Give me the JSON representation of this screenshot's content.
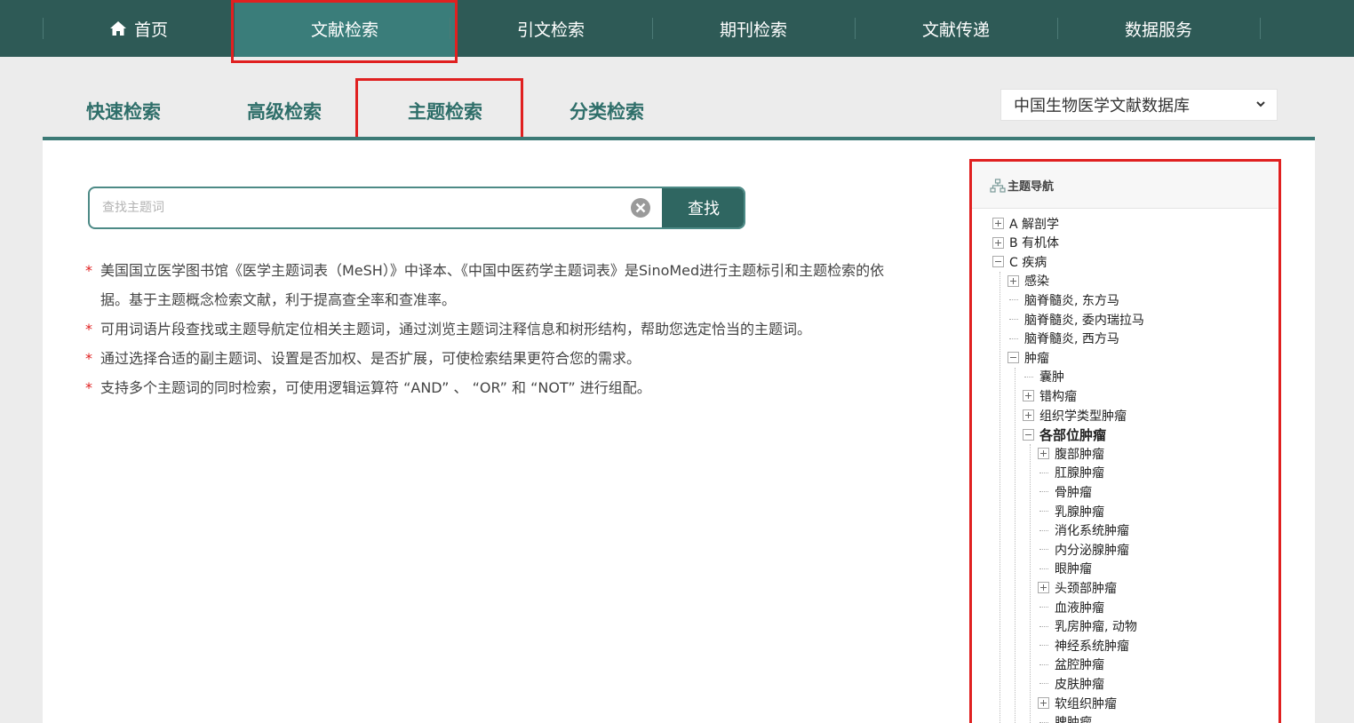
{
  "topnav": {
    "items": [
      {
        "label": "首页"
      },
      {
        "label": "文献检索"
      },
      {
        "label": "引文检索"
      },
      {
        "label": "期刊检索"
      },
      {
        "label": "文献传递"
      },
      {
        "label": "数据服务"
      }
    ],
    "active": "文献检索"
  },
  "subtabs": {
    "items": [
      {
        "label": "快速检索"
      },
      {
        "label": "高级检索"
      },
      {
        "label": "主题检索"
      },
      {
        "label": "分类检索"
      }
    ],
    "active": "主题检索"
  },
  "database_select": {
    "value": "中国生物医学文献数据库"
  },
  "search": {
    "placeholder": "查找主题词",
    "value": "",
    "button_label": "查找"
  },
  "notes": [
    "美国国立医学图书馆《医学主题词表（MeSH）》中译本、《中国中医药学主题词表》是SinoMed进行主题标引和主题检索的依据。基于主题概念检索文献，利于提高查全率和查准率。",
    "可用词语片段查找或主题导航定位相关主题词，通过浏览主题词注释信息和树形结构，帮助您选定恰当的主题词。",
    "通过选择合适的副主题词、设置是否加权、是否扩展，可使检索结果更符合您的需求。",
    "支持多个主题词的同时检索，可使用逻辑运算符 “AND” 、 “OR” 和 “NOT” 进行组配。"
  ],
  "tree": {
    "title": "主题导航",
    "nodes": [
      {
        "label": "A 解剖学",
        "level": 0,
        "state": "plus"
      },
      {
        "label": "B 有机体",
        "level": 0,
        "state": "plus"
      },
      {
        "label": "C 疾病",
        "level": 0,
        "state": "minus"
      },
      {
        "label": "感染",
        "level": 1,
        "state": "plus"
      },
      {
        "label": "脑脊髓炎, 东方马",
        "level": 1,
        "state": "leaf"
      },
      {
        "label": "脑脊髓炎, 委内瑞拉马",
        "level": 1,
        "state": "leaf"
      },
      {
        "label": "脑脊髓炎, 西方马",
        "level": 1,
        "state": "leaf"
      },
      {
        "label": "肿瘤",
        "level": 1,
        "state": "minus"
      },
      {
        "label": "囊肿",
        "level": 2,
        "state": "leaf"
      },
      {
        "label": "错构瘤",
        "level": 2,
        "state": "plus"
      },
      {
        "label": "组织学类型肿瘤",
        "level": 2,
        "state": "plus"
      },
      {
        "label": "各部位肿瘤",
        "level": 2,
        "state": "minus",
        "bold": true
      },
      {
        "label": "腹部肿瘤",
        "level": 3,
        "state": "plus"
      },
      {
        "label": "肛腺肿瘤",
        "level": 3,
        "state": "leaf"
      },
      {
        "label": "骨肿瘤",
        "level": 3,
        "state": "leaf"
      },
      {
        "label": "乳腺肿瘤",
        "level": 3,
        "state": "leaf"
      },
      {
        "label": "消化系统肿瘤",
        "level": 3,
        "state": "leaf"
      },
      {
        "label": "内分泌腺肿瘤",
        "level": 3,
        "state": "leaf"
      },
      {
        "label": "眼肿瘤",
        "level": 3,
        "state": "leaf"
      },
      {
        "label": "头颈部肿瘤",
        "level": 3,
        "state": "plus"
      },
      {
        "label": "血液肿瘤",
        "level": 3,
        "state": "leaf"
      },
      {
        "label": "乳房肿瘤, 动物",
        "level": 3,
        "state": "leaf"
      },
      {
        "label": "神经系统肿瘤",
        "level": 3,
        "state": "leaf"
      },
      {
        "label": "盆腔肿瘤",
        "level": 3,
        "state": "leaf"
      },
      {
        "label": "皮肤肿瘤",
        "level": 3,
        "state": "leaf"
      },
      {
        "label": "软组织肿瘤",
        "level": 3,
        "state": "plus"
      },
      {
        "label": "脾肿瘤",
        "level": 3,
        "state": "leaf"
      }
    ]
  },
  "colors": {
    "nav_bg": "#2e5a56",
    "nav_active": "#3a7d7a",
    "accent": "#2f6f6a",
    "highlight_box": "#e02020"
  }
}
